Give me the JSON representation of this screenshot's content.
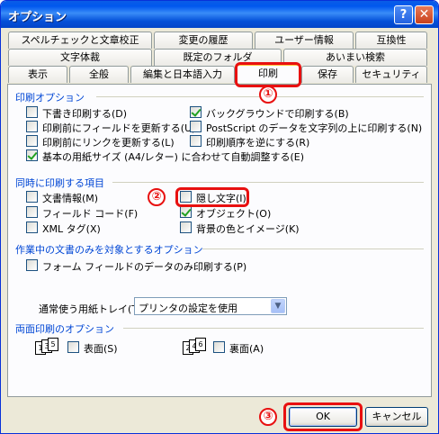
{
  "window": {
    "title": "オプション",
    "help_label": "?",
    "close_label": "✕"
  },
  "tabs": {
    "row1": [
      "スペルチェックと文章校正",
      "変更の履歴",
      "ユーザー情報",
      "互換性"
    ],
    "row2": [
      "文字体裁",
      "既定のフォルダ",
      "あいまい検索"
    ],
    "row3": [
      "表示",
      "全般",
      "編集と日本語入力",
      "印刷",
      "保存",
      "セキュリティ"
    ],
    "active": "印刷"
  },
  "print_options": {
    "heading": "印刷オプション",
    "items": [
      {
        "label": "下書き印刷する(D)",
        "checked": false
      },
      {
        "label": "印刷前にフィールドを更新する(U)",
        "checked": false
      },
      {
        "label": "印刷前にリンクを更新する(L)",
        "checked": false
      },
      {
        "label": "基本の用紙サイズ (A4/レター) に合わせて自動調整する(E)",
        "checked": true
      },
      {
        "label": "バックグラウンドで印刷する(B)",
        "checked": true
      },
      {
        "label": "PostScript のデータを文字列の上に印刷する(N)",
        "checked": false
      },
      {
        "label": "印刷順序を逆にする(R)",
        "checked": false
      }
    ]
  },
  "include_items": {
    "heading": "同時に印刷する項目",
    "items": [
      {
        "label": "文書情報(M)",
        "checked": false
      },
      {
        "label": "フィールド コード(F)",
        "checked": false
      },
      {
        "label": "XML タグ(X)",
        "checked": false
      },
      {
        "label": "隠し文字(I)",
        "checked": false
      },
      {
        "label": "オブジェクト(O)",
        "checked": true
      },
      {
        "label": "背景の色とイメージ(K)",
        "checked": false
      }
    ]
  },
  "current_doc": {
    "heading": "作業中の文書のみを対象とするオプション",
    "items": [
      {
        "label": "フォーム フィールドのデータのみ印刷する(P)",
        "checked": false
      }
    ]
  },
  "tray": {
    "label": "通常使う用紙トレイ(T)",
    "value": "プリンタの設定を使用",
    "arrow": "▼"
  },
  "duplex": {
    "heading": "両面印刷のオプション",
    "front": {
      "label": "表面(S)",
      "checked": false,
      "pages": [
        "1",
        "3",
        "5"
      ]
    },
    "back": {
      "label": "裏面(A)",
      "checked": false,
      "pages": [
        "2",
        "4",
        "6"
      ]
    }
  },
  "buttons": {
    "ok": "OK",
    "cancel": "キャンセル"
  },
  "markers": [
    "①",
    "②",
    "③"
  ],
  "colors": {
    "accent": "#0046d5",
    "annotation": "#e81010",
    "titlebar": "#0058ee"
  }
}
